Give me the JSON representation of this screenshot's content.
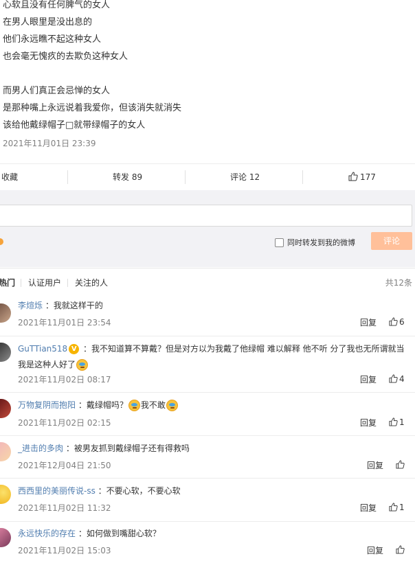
{
  "post": {
    "lines": [
      "心软且没有任何脾气的女人",
      "在男人眼里是没出息的",
      "他们永远瞧不起这种女人",
      "也会毫无愧疚的去欺负这种女人",
      "",
      "而男人们真正会忌惮的女人",
      "是那种嘴上永远说着我爱你，但该消失就消失",
      "该给他戴绿帽子□就带绿帽子的女人"
    ],
    "date": "2021年11月01日 23:39"
  },
  "actions": {
    "favorite": "收藏",
    "repost": "转发 89",
    "comment": "评论 12",
    "like": "177"
  },
  "composer": {
    "repost_label": "同时转发到我的微博",
    "submit_label": "评论"
  },
  "filters": {
    "hot": "热门",
    "verified": "认证用户",
    "following": "关注的人",
    "total": "共12条"
  },
  "comments": [
    {
      "user": "李煊烁",
      "text": "我就这样干的",
      "date": "2021年11月01日 23:54",
      "reply": "回复",
      "likes": "6"
    },
    {
      "user": "GuTTian518",
      "text": "我不知道算不算戴？但是对方以为我戴了他绿帽 难以解释 他不听 分了我也无所谓就当我是这种人好了",
      "date": "2021年11月02日 08:17",
      "reply": "回复",
      "likes": "4"
    },
    {
      "user": "万物复阴而抱阳",
      "text": "戴绿帽吗？",
      "text2": "我不敢",
      "date": "2021年11月02日 02:15",
      "reply": "回复",
      "likes": "1"
    },
    {
      "user": "_进击的多肉",
      "text": "被男友抓到戴绿帽子还有得救吗",
      "date": "2021年12月04日 21:50",
      "reply": "回复",
      "likes": ""
    },
    {
      "user": "西西里的美丽传说-ss",
      "text": "不要心软，不要心软",
      "date": "2021年11月02日 11:32",
      "reply": "回复",
      "likes": "1"
    },
    {
      "user": "永远快乐的存在",
      "text": "如何做到嘴甜心软？",
      "date": "2021年11月02日 15:03",
      "reply": "回复",
      "likes": ""
    }
  ],
  "colors": {
    "username": "#507daf",
    "submit_disabled": "#ffc09a",
    "badge": "#f7b400"
  }
}
